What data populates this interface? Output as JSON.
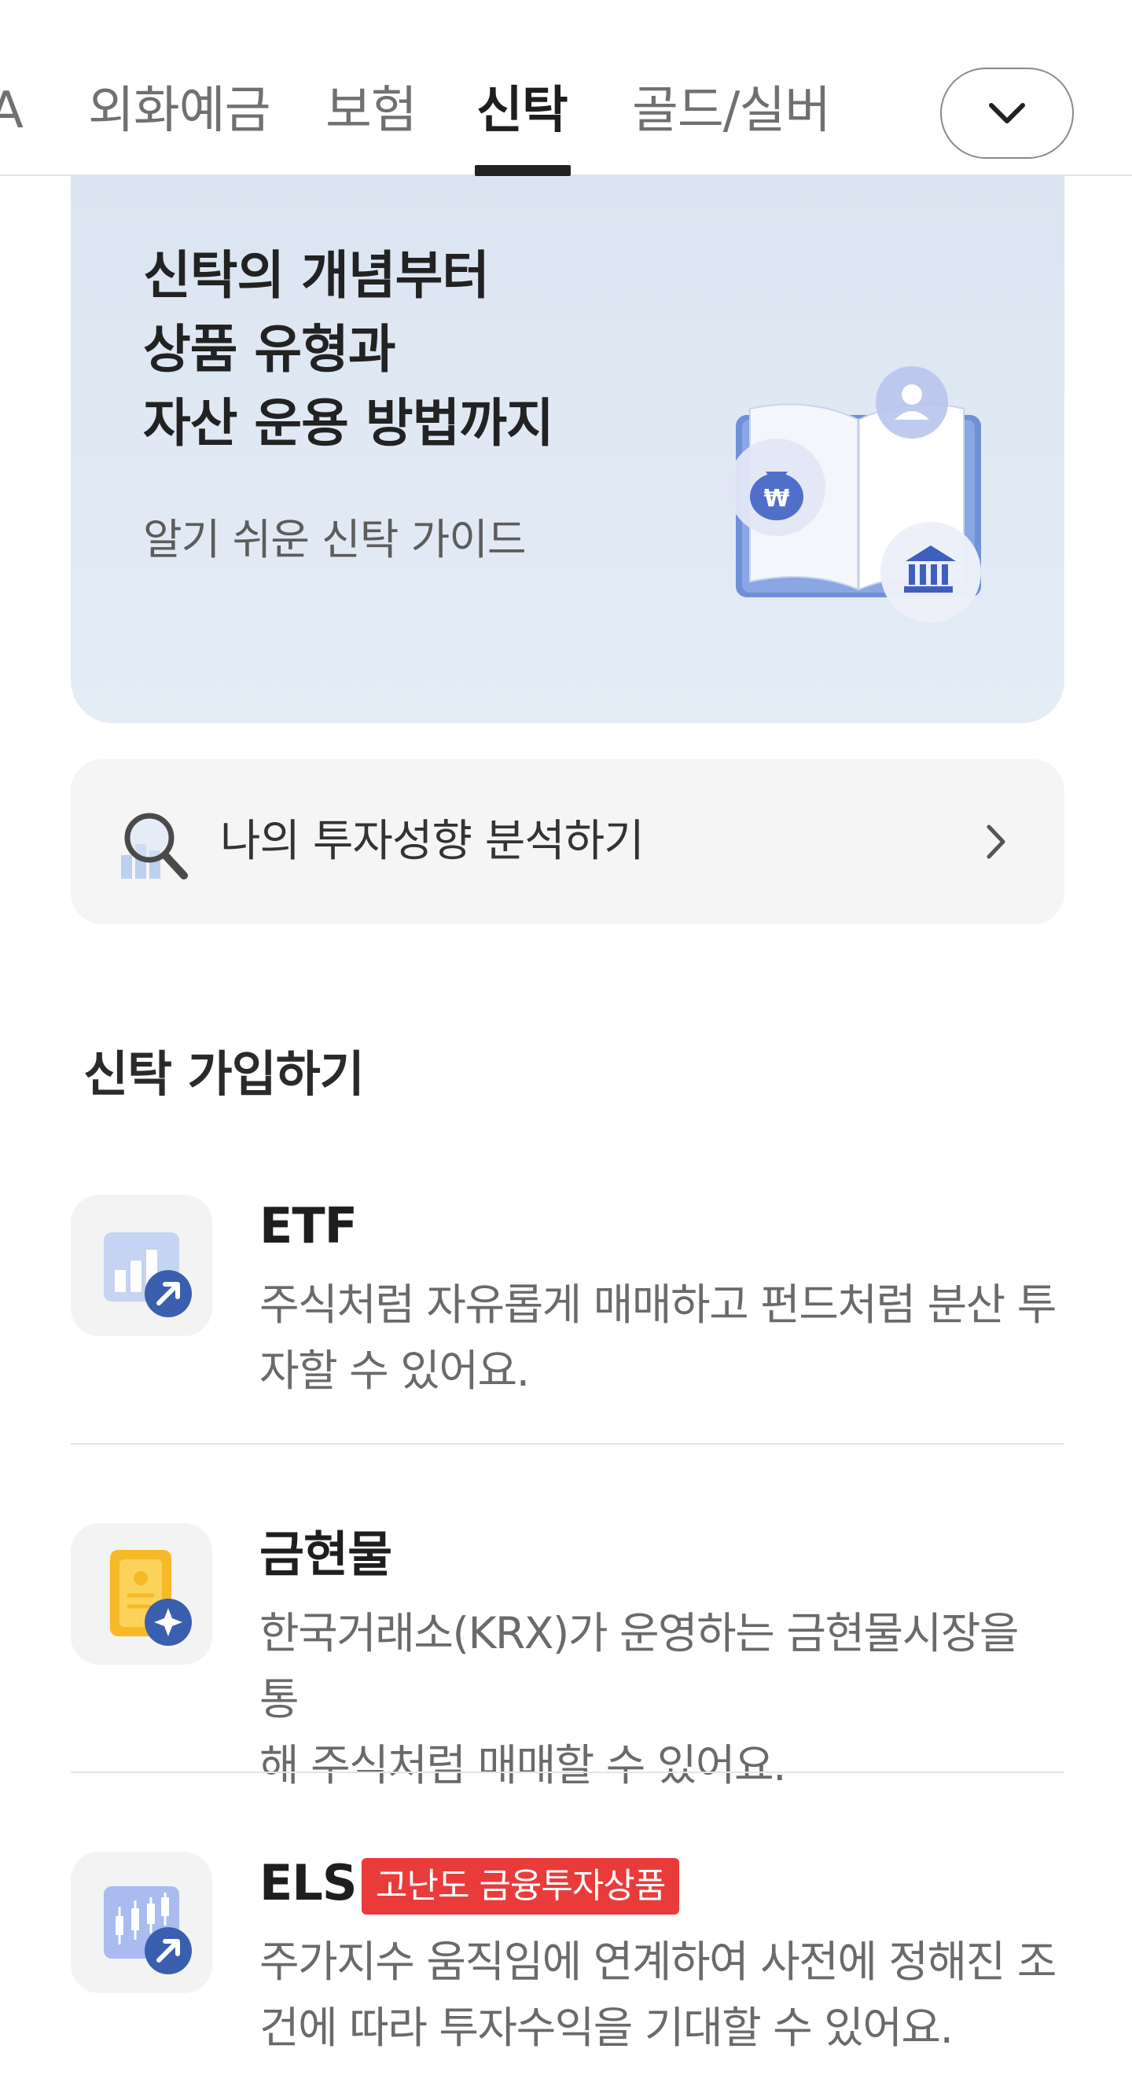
{
  "tabs": [
    {
      "label": "A"
    },
    {
      "label": "외화예금"
    },
    {
      "label": "보험"
    },
    {
      "label": "신탁",
      "active": true
    },
    {
      "label": "골드/실버"
    }
  ],
  "tab_more_icon": "chevron-down-icon",
  "banner": {
    "title_lines": [
      "신탁의 개념부터",
      "상품 유형과",
      "자산 운용 방법까지"
    ],
    "subtitle": "알기 쉬운 신탁 가이드",
    "currency_symbol": "₩"
  },
  "analysis": {
    "label": "나의 투자성향 분석하기",
    "icon": "magnifier-chart-icon",
    "chevron": "chevron-right-icon"
  },
  "section": {
    "title": "신탁 가입하기"
  },
  "products": [
    {
      "name": "ETF",
      "desc_lines": [
        "주식처럼 자유롭게 매매하고 펀드처럼 분산 투",
        "자할 수 있어요."
      ],
      "icon": "etf-chart-icon"
    },
    {
      "name": "금현물",
      "desc_lines": [
        "한국거래소(KRX)가 운영하는 금현물시장을 통",
        "해 주식처럼 매매할 수 있어요."
      ],
      "icon": "gold-bar-icon"
    },
    {
      "name": "ELS",
      "badge": "고난도 금융투자상품",
      "desc_lines": [
        "주가지수 움직임에 연계하여 사전에 정해진 조",
        "건에 따라 투자수익을 기대할 수 있어요."
      ],
      "icon": "candlestick-chart-icon"
    }
  ],
  "colors": {
    "accent_blue": "#3a5fae",
    "badge_red": "#ea3b3b",
    "banner_bg": "#dde6f2"
  }
}
